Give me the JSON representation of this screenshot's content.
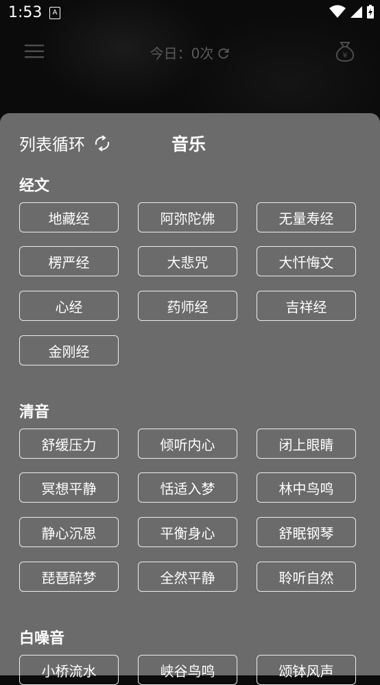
{
  "status": {
    "time": "1:53",
    "notif_letter": "A"
  },
  "header": {
    "today_label": "今日：0次"
  },
  "sheet": {
    "mode_label": "列表循环",
    "title": "音乐",
    "sections": [
      {
        "title": "经文",
        "items": [
          "地藏经",
          "阿弥陀佛",
          "无量寿经",
          "楞严经",
          "大悲咒",
          "大忏悔文",
          "心经",
          "药师经",
          "吉祥经",
          "金刚经"
        ]
      },
      {
        "title": "清音",
        "items": [
          "舒缓压力",
          "倾听内心",
          "闭上眼睛",
          "冥想平静",
          "恬适入梦",
          "林中鸟鸣",
          "静心沉思",
          "平衡身心",
          "舒眠钢琴",
          "琵琶醉梦",
          "全然平静",
          "聆听自然"
        ]
      },
      {
        "title": "白噪音",
        "items": [
          "小桥流水",
          "峡谷鸟鸣",
          "颂钵风声"
        ]
      }
    ]
  }
}
